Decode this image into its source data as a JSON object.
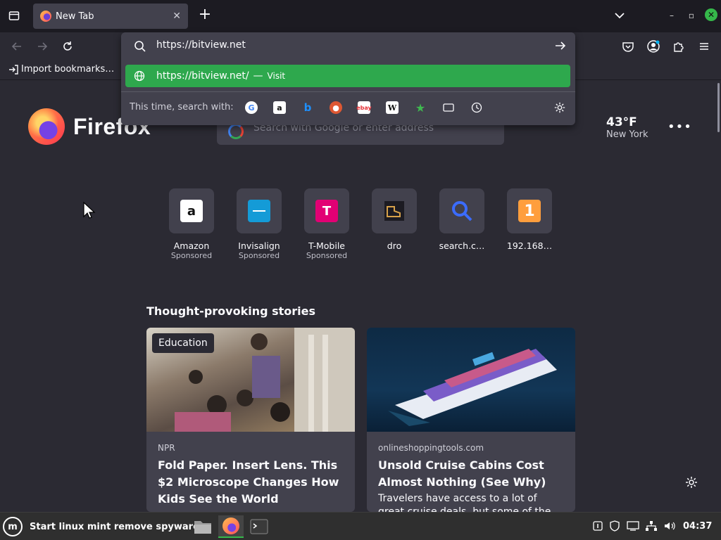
{
  "browser": {
    "tab": {
      "title": "New Tab"
    },
    "urlbar": {
      "value": "https://bitview.net",
      "suggestion_url": "https://bitview.net/",
      "suggestion_sep": "—",
      "suggestion_action": "Visit",
      "search_with_label": "This time, search with:",
      "engines": [
        "google-icon",
        "amazon-icon",
        "bing-icon",
        "duckduckgo-icon",
        "ebay-icon",
        "wikipedia-icon",
        "bookmarks-icon",
        "tabs-icon",
        "history-icon"
      ]
    },
    "bookmarks": {
      "import_label": "Import bookmarks…"
    }
  },
  "newtab": {
    "brand": "Firefox",
    "search_placeholder": "Search with Google or enter address",
    "weather": {
      "temp": "43°F",
      "city": "New York"
    },
    "tiles": [
      {
        "label": "Amazon",
        "sub": "Sponsored",
        "glyph": "a",
        "bg": "#ffffff",
        "fg": "#111111"
      },
      {
        "label": "Invisalign",
        "sub": "Sponsored",
        "glyph": "",
        "bg": "#149bd7",
        "fg": "#ffffff"
      },
      {
        "label": "T-Mobile",
        "sub": "Sponsored",
        "glyph": "T",
        "bg": "#e20074",
        "fg": "#ffffff"
      },
      {
        "label": "dro",
        "sub": "",
        "glyph": "",
        "bg": "#2b2a33",
        "fg": "#d8a24a"
      },
      {
        "label": "search.c…",
        "sub": "",
        "glyph": "",
        "bg": "#42414d",
        "fg": "#3b6cff"
      },
      {
        "label": "192.168…",
        "sub": "",
        "glyph": "1",
        "bg": "#ff9e3d",
        "fg": "#ffffff"
      }
    ],
    "stories_title": "Thought-provoking stories",
    "stories": [
      {
        "badge": "Education",
        "source": "NPR",
        "headline": "Fold Paper. Insert Lens. This $2 Microscope Changes How Kids See the World",
        "excerpt": ""
      },
      {
        "badge": "",
        "source": "onlineshoppingtools.com",
        "headline": "Unsold Cruise Cabins Cost Almost Nothing (See Why)",
        "excerpt": "Travelers have access to a lot of great cruise deals, but some of the best ones"
      }
    ]
  },
  "taskbar": {
    "menu_label": "Start linux mint remove spyware",
    "clock": "04:37"
  }
}
